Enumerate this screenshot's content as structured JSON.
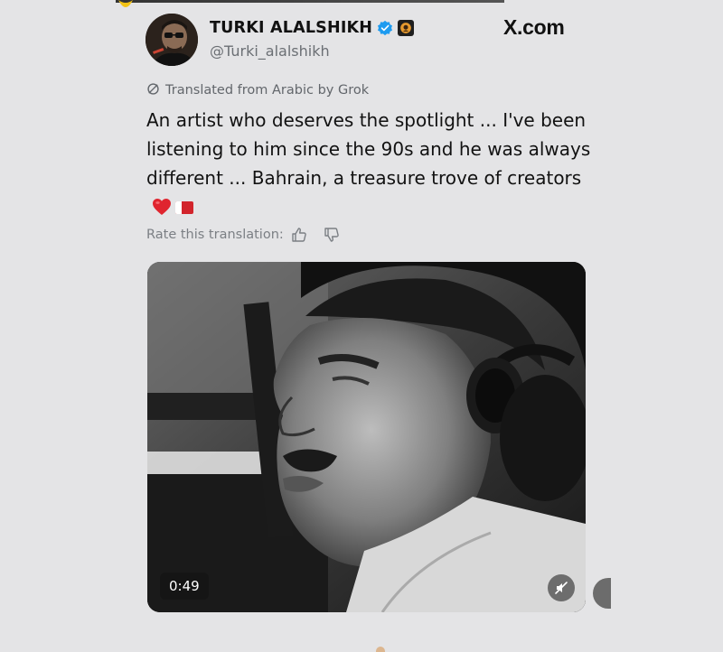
{
  "header": {
    "display_name": "TURKI ALALSHIKH",
    "handle": "@Turki_alalshikh",
    "verified_icon": "verified-badge-icon",
    "affiliate_icon": "organization-badge-icon",
    "watermark": "X.com"
  },
  "translation": {
    "notice": "Translated from Arabic by Grok",
    "rate_label": "Rate this translation:"
  },
  "tweet": {
    "text": "An artist who deserves the spotlight ... I've been listening to him since the 90s and he was always different ... Bahrain, a treasure trove of creators",
    "emoji": [
      "red-heart-icon",
      "bahrain-flag-icon"
    ]
  },
  "video": {
    "duration": "0:49",
    "muted": true
  },
  "colors": {
    "background": "#e4e4e6",
    "verified_blue": "#1d9bf0",
    "secondary_text": "#6b6f74",
    "heart_red": "#e0252f"
  }
}
